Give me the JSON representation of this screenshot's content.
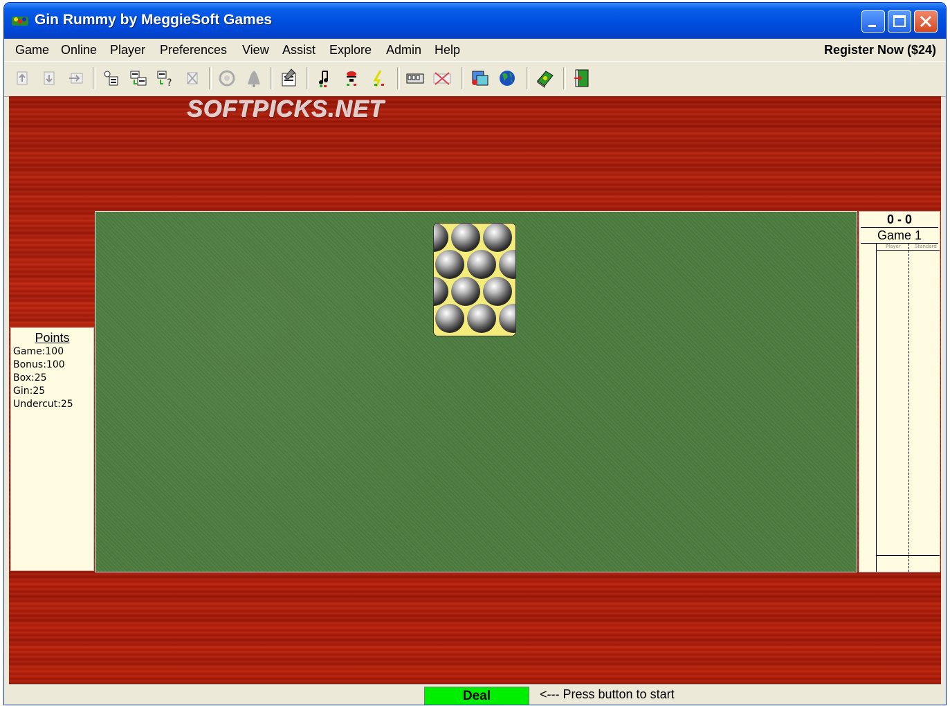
{
  "window": {
    "title": "Gin Rummy by MeggieSoft Games"
  },
  "menu": {
    "items": [
      "Game",
      "Online",
      "Player",
      "Preferences",
      "View",
      "Assist",
      "Explore",
      "Admin",
      "Help"
    ],
    "register": "Register Now ($24)"
  },
  "toolbar": {
    "icons": [
      "new-hand-icon",
      "undo-icon",
      "redo-icon",
      "player-icon",
      "players-icon",
      "player-help-icon",
      "remove-player-icon",
      "hint-icon",
      "bell-icon",
      "preferences-icon",
      "music-icon",
      "sound-icon",
      "effects-icon",
      "video-icon",
      "video-off-icon",
      "online-icon",
      "globe-icon",
      "help-book-icon",
      "exit-icon"
    ]
  },
  "watermark": "SOFTPICKS.NET",
  "points": {
    "title": "Points",
    "lines": [
      "Game:100",
      "Bonus:100",
      "Box:25",
      "Gin:25",
      "Undercut:25"
    ]
  },
  "scoreboard": {
    "score": "0 - 0",
    "game_label": "Game 1",
    "col1": "Player",
    "col2": "Standard"
  },
  "status": {
    "deal_label": "Deal",
    "message": "<--- Press button to start"
  }
}
